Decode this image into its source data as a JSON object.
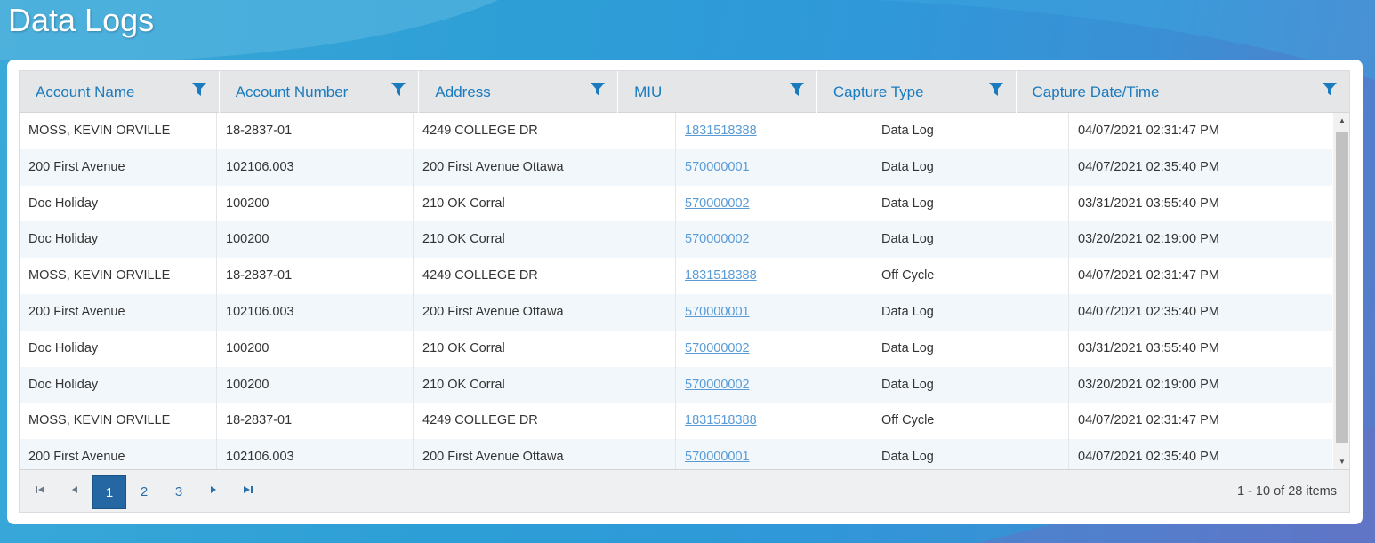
{
  "page": {
    "title": "Data Logs"
  },
  "table": {
    "columns": [
      {
        "label": "Account Name",
        "key": "account_name"
      },
      {
        "label": "Account Number",
        "key": "account_number"
      },
      {
        "label": "Address",
        "key": "address"
      },
      {
        "label": "MIU",
        "key": "miu"
      },
      {
        "label": "Capture Type",
        "key": "capture_type"
      },
      {
        "label": "Capture Date/Time",
        "key": "capture_datetime"
      }
    ],
    "rows": [
      {
        "account_name": "MOSS, KEVIN ORVILLE",
        "account_number": "18-2837-01",
        "address": "4249 COLLEGE DR",
        "miu": "1831518388",
        "capture_type": "Data Log",
        "capture_datetime": "04/07/2021 02:31:47 PM"
      },
      {
        "account_name": "200 First Avenue",
        "account_number": "102106.003",
        "address": "200 First Avenue Ottawa",
        "miu": "570000001",
        "capture_type": "Data Log",
        "capture_datetime": "04/07/2021 02:35:40 PM"
      },
      {
        "account_name": "Doc Holiday",
        "account_number": "100200",
        "address": "210 OK Corral",
        "miu": "570000002",
        "capture_type": "Data Log",
        "capture_datetime": "03/31/2021 03:55:40 PM"
      },
      {
        "account_name": "Doc Holiday",
        "account_number": "100200",
        "address": "210 OK Corral",
        "miu": "570000002",
        "capture_type": "Data Log",
        "capture_datetime": "03/20/2021 02:19:00 PM"
      },
      {
        "account_name": "MOSS, KEVIN ORVILLE",
        "account_number": "18-2837-01",
        "address": "4249 COLLEGE DR",
        "miu": "1831518388",
        "capture_type": "Off Cycle",
        "capture_datetime": "04/07/2021 02:31:47 PM"
      },
      {
        "account_name": "200 First Avenue",
        "account_number": "102106.003",
        "address": "200 First Avenue Ottawa",
        "miu": "570000001",
        "capture_type": "Data Log",
        "capture_datetime": "04/07/2021 02:35:40 PM"
      },
      {
        "account_name": "Doc Holiday",
        "account_number": "100200",
        "address": "210 OK Corral",
        "miu": "570000002",
        "capture_type": "Data Log",
        "capture_datetime": "03/31/2021 03:55:40 PM"
      },
      {
        "account_name": "Doc Holiday",
        "account_number": "100200",
        "address": "210 OK Corral",
        "miu": "570000002",
        "capture_type": "Data Log",
        "capture_datetime": "03/20/2021 02:19:00 PM"
      },
      {
        "account_name": "MOSS, KEVIN ORVILLE",
        "account_number": "18-2837-01",
        "address": "4249 COLLEGE DR",
        "miu": "1831518388",
        "capture_type": "Off Cycle",
        "capture_datetime": "04/07/2021 02:31:47 PM"
      },
      {
        "account_name": "200 First Avenue",
        "account_number": "102106.003",
        "address": "200 First Avenue Ottawa",
        "miu": "570000001",
        "capture_type": "Data Log",
        "capture_datetime": "04/07/2021 02:35:40 PM"
      }
    ]
  },
  "pager": {
    "pages": [
      "1",
      "2",
      "3"
    ],
    "current_page": "1",
    "info": "1 - 10 of 28 items"
  },
  "icons": {
    "filter": "filter-icon",
    "first": "first-page-icon",
    "prev": "previous-page-icon",
    "next": "next-page-icon",
    "last": "last-page-icon"
  },
  "colors": {
    "header_text": "#1a7bbf",
    "link": "#5a9bd5",
    "active_page": "#2467a3"
  }
}
